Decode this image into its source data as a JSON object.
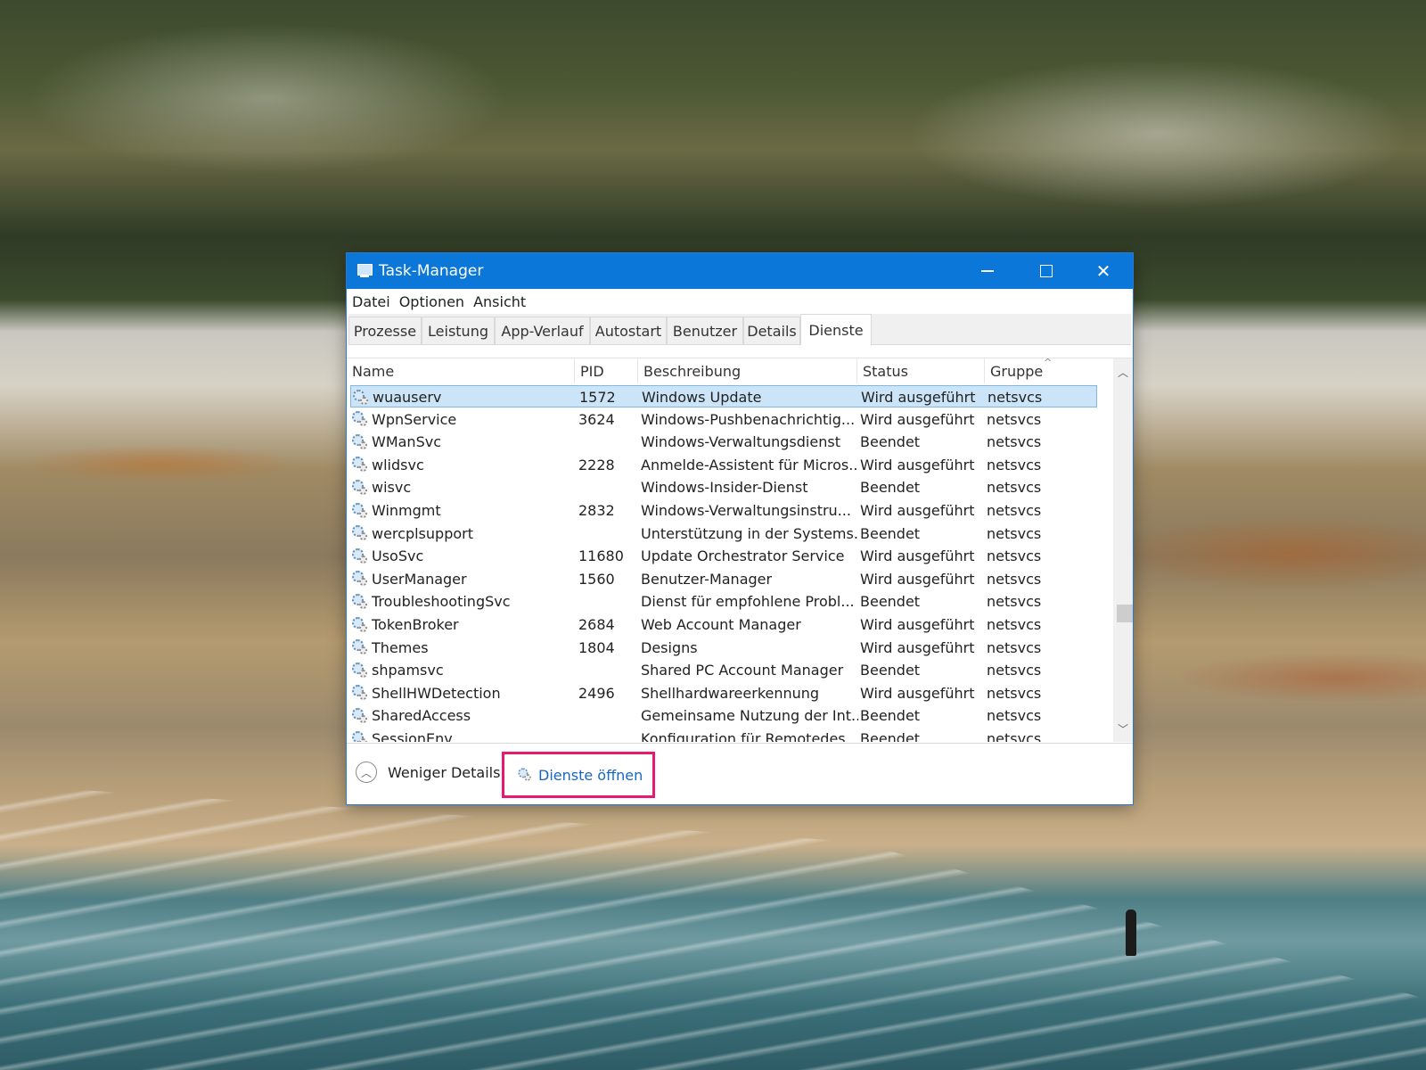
{
  "window": {
    "title": "Task-Manager"
  },
  "menu": {
    "items": [
      {
        "label": "Datei"
      },
      {
        "label": "Optionen"
      },
      {
        "label": "Ansicht"
      }
    ]
  },
  "tabs": [
    {
      "label": "Prozesse"
    },
    {
      "label": "Leistung"
    },
    {
      "label": "App-Verlauf"
    },
    {
      "label": "Autostart"
    },
    {
      "label": "Benutzer"
    },
    {
      "label": "Details"
    },
    {
      "label": "Dienste"
    }
  ],
  "table": {
    "columns": [
      "Name",
      "PID",
      "Beschreibung",
      "Status",
      "Gruppe"
    ],
    "rows": [
      {
        "name": "wuauserv",
        "pid": "1572",
        "desc": "Windows Update",
        "status": "Wird ausgeführt",
        "group": "netsvcs"
      },
      {
        "name": "WpnService",
        "pid": "3624",
        "desc": "Windows-Pushbenachrichtig...",
        "status": "Wird ausgeführt",
        "group": "netsvcs"
      },
      {
        "name": "WManSvc",
        "pid": "",
        "desc": "Windows-Verwaltungsdienst",
        "status": "Beendet",
        "group": "netsvcs"
      },
      {
        "name": "wlidsvc",
        "pid": "2228",
        "desc": "Anmelde-Assistent für Micros...",
        "status": "Wird ausgeführt",
        "group": "netsvcs"
      },
      {
        "name": "wisvc",
        "pid": "",
        "desc": "Windows-Insider-Dienst",
        "status": "Beendet",
        "group": "netsvcs"
      },
      {
        "name": "Winmgmt",
        "pid": "2832",
        "desc": "Windows-Verwaltungsinstru...",
        "status": "Wird ausgeführt",
        "group": "netsvcs"
      },
      {
        "name": "wercplsupport",
        "pid": "",
        "desc": "Unterstützung in der Systems...",
        "status": "Beendet",
        "group": "netsvcs"
      },
      {
        "name": "UsoSvc",
        "pid": "11680",
        "desc": "Update Orchestrator Service",
        "status": "Wird ausgeführt",
        "group": "netsvcs"
      },
      {
        "name": "UserManager",
        "pid": "1560",
        "desc": "Benutzer-Manager",
        "status": "Wird ausgeführt",
        "group": "netsvcs"
      },
      {
        "name": "TroubleshootingSvc",
        "pid": "",
        "desc": "Dienst für empfohlene Probl...",
        "status": "Beendet",
        "group": "netsvcs"
      },
      {
        "name": "TokenBroker",
        "pid": "2684",
        "desc": "Web Account Manager",
        "status": "Wird ausgeführt",
        "group": "netsvcs"
      },
      {
        "name": "Themes",
        "pid": "1804",
        "desc": "Designs",
        "status": "Wird ausgeführt",
        "group": "netsvcs"
      },
      {
        "name": "shpamsvc",
        "pid": "",
        "desc": "Shared PC Account Manager",
        "status": "Beendet",
        "group": "netsvcs"
      },
      {
        "name": "ShellHWDetection",
        "pid": "2496",
        "desc": "Shellhardwareerkennung",
        "status": "Wird ausgeführt",
        "group": "netsvcs"
      },
      {
        "name": "SharedAccess",
        "pid": "",
        "desc": "Gemeinsame Nutzung der Int...",
        "status": "Beendet",
        "group": "netsvcs"
      },
      {
        "name": "SessionEnv",
        "pid": "",
        "desc": "Konfiguration für Remotedes...",
        "status": "Beendet",
        "group": "netsvcs"
      }
    ]
  },
  "footer": {
    "less_details": "Weniger Details",
    "open_services": "Dienste öffnen"
  },
  "colors": {
    "titlebar": "#0b77d8",
    "selection": "#cce4f7",
    "highlight_box": "#e8196e",
    "link": "#1667c2"
  }
}
